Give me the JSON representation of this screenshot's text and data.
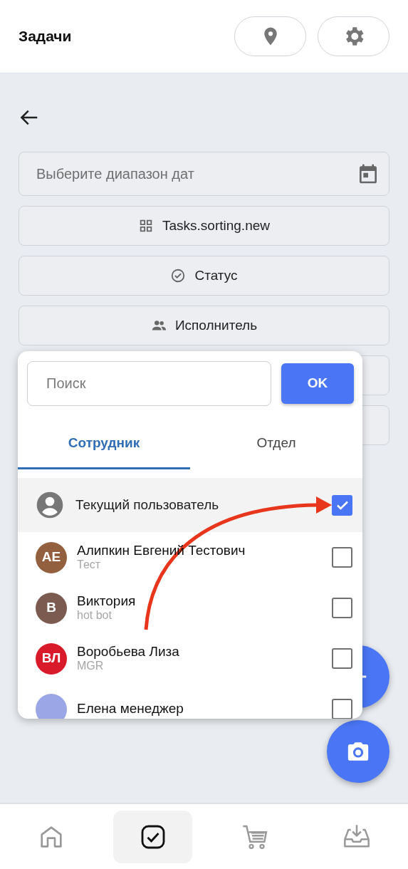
{
  "header": {
    "title": "Задачи"
  },
  "filters": [
    {
      "kind": "date",
      "placeholder": "Выберите диапазон дат"
    },
    {
      "kind": "sorting",
      "label": "Tasks.sorting.new"
    },
    {
      "kind": "status",
      "label": "Статус"
    },
    {
      "kind": "executor",
      "label": "Исполнитель"
    },
    {
      "kind": "covered"
    },
    {
      "kind": "covered"
    }
  ],
  "picker": {
    "search": {
      "placeholder": "Поиск"
    },
    "ok": "OK",
    "tabs": [
      {
        "label": "Сотрудник",
        "selected": true
      },
      {
        "label": "Отдел",
        "selected": false
      }
    ],
    "current_user": {
      "label": "Текущий пользователь",
      "checked": true
    },
    "people": [
      {
        "initials": "АЕ",
        "name": "Алипкин Евгений Тестович",
        "subtitle": "Тест",
        "color": "#93603f",
        "checked": false
      },
      {
        "initials": "В",
        "name": "Виктория",
        "subtitle": "hot bot",
        "color": "#7b5b50",
        "checked": false
      },
      {
        "initials": "ВЛ",
        "name": "Воробьева Лиза",
        "subtitle": "MGR",
        "color": "#d91a2a",
        "checked": false
      },
      {
        "name": "Елена менеджер",
        "color": "#9ba6e6",
        "checked": false
      }
    ]
  },
  "bottom_nav": [
    {
      "kind": "home",
      "selected": false
    },
    {
      "kind": "tasks",
      "selected": true
    },
    {
      "kind": "cart",
      "selected": false
    },
    {
      "kind": "inbox",
      "selected": false
    }
  ]
}
